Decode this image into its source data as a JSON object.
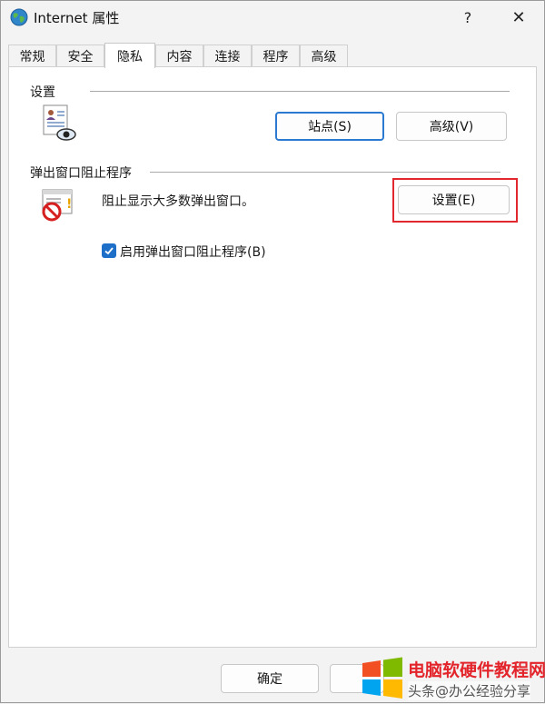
{
  "window": {
    "title": "Internet 属性",
    "help_label": "?",
    "close_label": "✕"
  },
  "tabs": [
    {
      "label": "常规"
    },
    {
      "label": "安全"
    },
    {
      "label": "隐私"
    },
    {
      "label": "内容"
    },
    {
      "label": "连接"
    },
    {
      "label": "程序"
    },
    {
      "label": "高级"
    }
  ],
  "settings_group": {
    "title": "设置",
    "sites_button": "站点(S)",
    "advanced_button": "高级(V)"
  },
  "popup_group": {
    "title": "弹出窗口阻止程序",
    "description": "阻止显示大多数弹出窗口。",
    "settings_button": "设置(E)",
    "enable_checkbox_label": "启用弹出窗口阻止程序(B)",
    "enable_checked": true
  },
  "footer": {
    "ok_button": "确定"
  },
  "watermark": {
    "title": "电脑软硬件教程网",
    "subtitle": "头条@办公经验分享"
  },
  "colors": {
    "accent": "#2b79d0",
    "highlight": "#e0282e",
    "checkbox": "#1e6fc7"
  }
}
